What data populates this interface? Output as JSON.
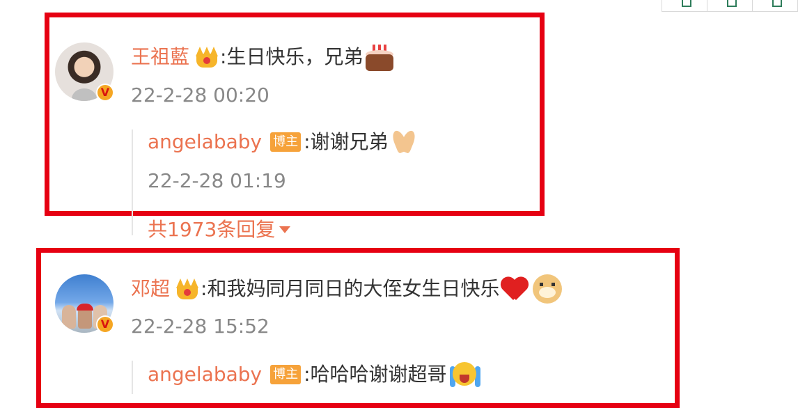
{
  "comments": [
    {
      "user": "王祖藍",
      "text": ":生日快乐，兄弟",
      "time": "22-2-28 00:20",
      "reply": {
        "user": "angelababy",
        "badge": "博主",
        "text": ":谢谢兄弟",
        "time": "22-2-28 01:19"
      },
      "more_replies": "共1973条回复"
    },
    {
      "user": "邓超",
      "text": ":和我妈同月同日的大侄女生日快乐",
      "time": "22-2-28 15:52",
      "reply": {
        "user": "angelababy",
        "badge": "博主",
        "text": ":哈哈哈谢谢超哥"
      }
    }
  ],
  "icons": {
    "verified_badge": "V",
    "crown": "crown-icon",
    "cake": "birthday-cake-emoji",
    "hands": "praying-hands-emoji",
    "heart": "red-heart-emoji",
    "doge": "doge-emoji",
    "cry": "crying-laughing-emoji"
  },
  "colors": {
    "username": "#eb7350",
    "highlight": "#e60012",
    "timestamp": "#888888",
    "blogger_badge": "#f6a23a"
  }
}
